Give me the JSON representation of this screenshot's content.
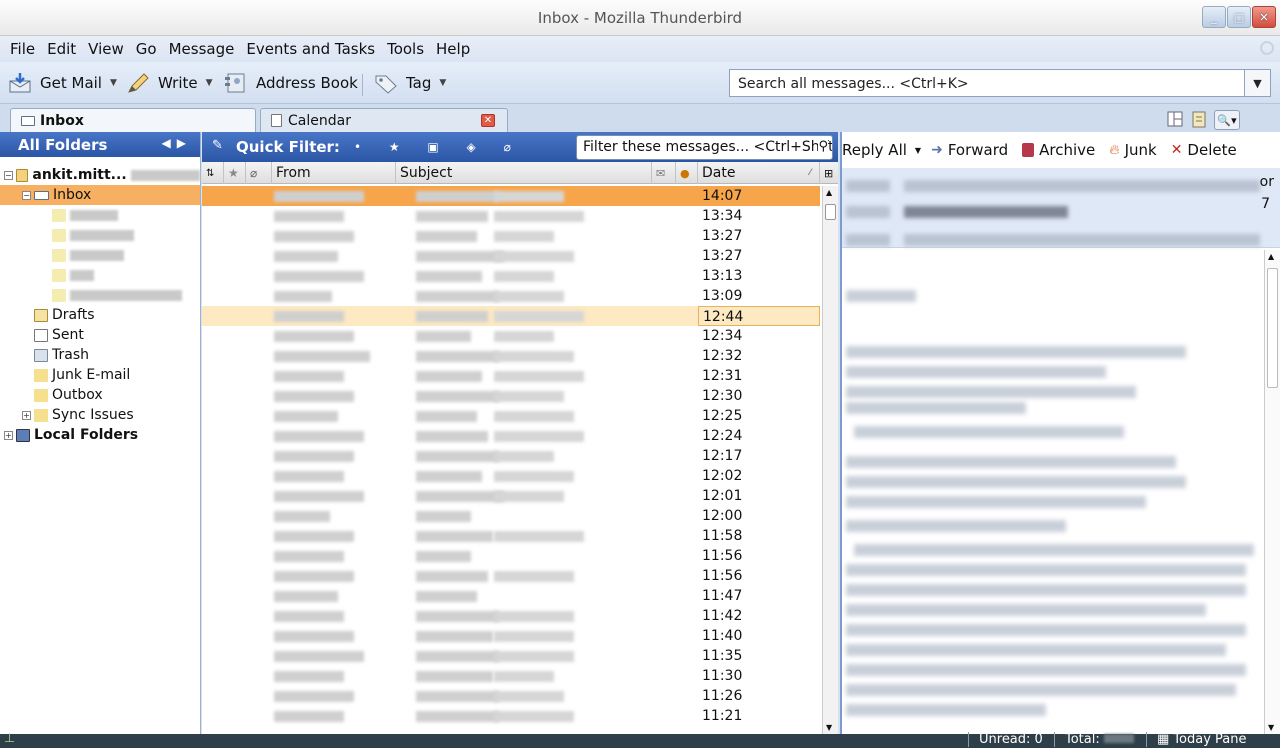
{
  "window": {
    "title": "Inbox - Mozilla Thunderbird"
  },
  "menu": [
    "File",
    "Edit",
    "View",
    "Go",
    "Message",
    "Events and Tasks",
    "Tools",
    "Help"
  ],
  "toolbar": {
    "get_mail": "Get Mail",
    "write": "Write",
    "address_book": "Address Book",
    "tag": "Tag",
    "search_placeholder": "Search all messages... <Ctrl+K>"
  },
  "tabs": [
    {
      "label": "Inbox",
      "active": true
    },
    {
      "label": "Calendar",
      "active": false
    }
  ],
  "folders": {
    "header": "All Folders",
    "account": "ankit.mitt...",
    "inbox": "Inbox",
    "drafts": "Drafts",
    "sent": "Sent",
    "trash": "Trash",
    "junk": "Junk E-mail",
    "outbox": "Outbox",
    "sync_issues": "Sync Issues",
    "local": "Local Folders"
  },
  "quick_filter": {
    "label": "Quick Filter:",
    "placeholder": "Filter these messages... <Ctrl+Shift+K>"
  },
  "columns": {
    "from": "From",
    "subject": "Subject",
    "date": "Date"
  },
  "messages": [
    {
      "date": "14:07"
    },
    {
      "date": "13:34"
    },
    {
      "date": "13:27"
    },
    {
      "date": "13:27"
    },
    {
      "date": "13:13"
    },
    {
      "date": "13:09"
    },
    {
      "date": "12:44"
    },
    {
      "date": "12:34"
    },
    {
      "date": "12:32"
    },
    {
      "date": "12:31"
    },
    {
      "date": "12:30"
    },
    {
      "date": "12:25"
    },
    {
      "date": "12:24"
    },
    {
      "date": "12:17"
    },
    {
      "date": "12:02"
    },
    {
      "date": "12:01"
    },
    {
      "date": "12:00"
    },
    {
      "date": "11:58"
    },
    {
      "date": "11:56"
    },
    {
      "date": "11:56"
    },
    {
      "date": "11:47"
    },
    {
      "date": "11:42"
    },
    {
      "date": "11:40"
    },
    {
      "date": "11:35"
    },
    {
      "date": "11:30"
    },
    {
      "date": "11:26"
    },
    {
      "date": "11:21"
    }
  ],
  "preview": {
    "reply_all": "Reply All",
    "forward": "Forward",
    "archive": "Archive",
    "junk": "Junk",
    "delete": "Delete",
    "header_fragment_1": "or",
    "header_fragment_2": "7"
  },
  "status": {
    "unread": "Unread: 0",
    "total": "Total:",
    "today_pane": "Today Pane"
  },
  "colors": {
    "selected_row": "#f7a54a",
    "highlight_row": "#fde9c2",
    "pane_header_blue": "#2b56a5",
    "folder_selected": "#f7b061"
  }
}
